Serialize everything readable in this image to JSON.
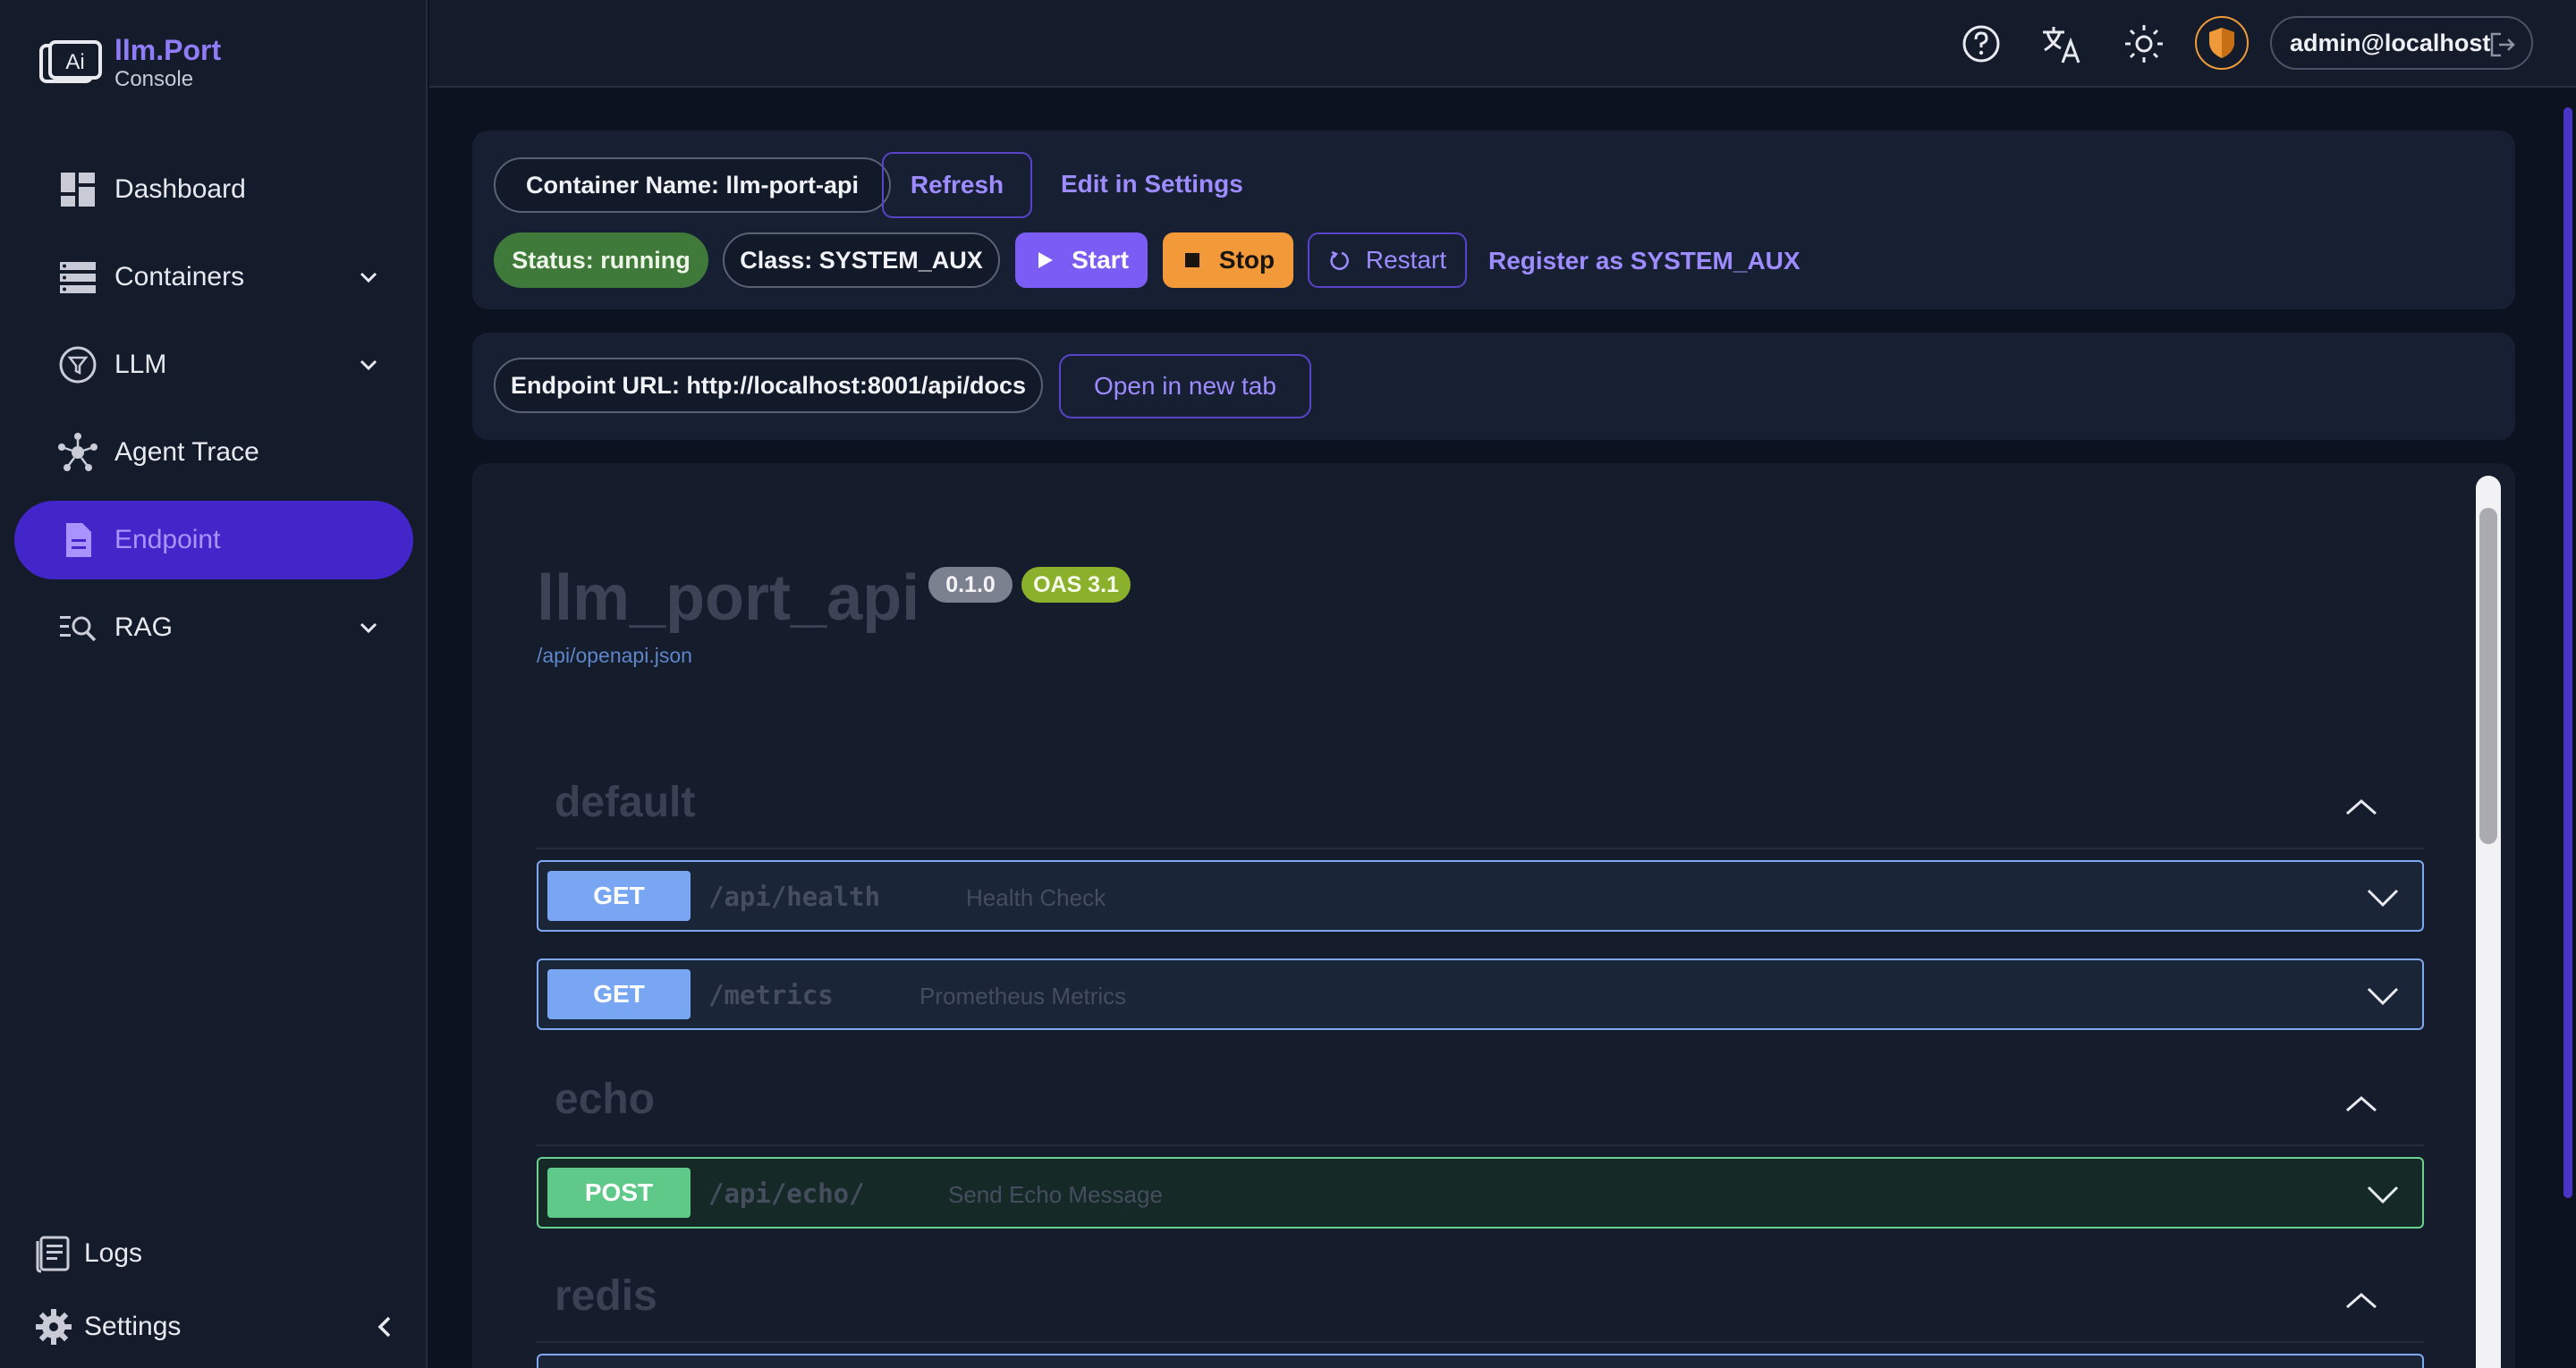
{
  "brand": {
    "name": "llm.Port",
    "subtitle": "Console"
  },
  "sidebar": {
    "items": [
      {
        "label": "Dashboard",
        "icon": "dashboard-icon"
      },
      {
        "label": "Containers",
        "icon": "server-stack-icon"
      },
      {
        "label": "LLM",
        "icon": "filter-funnel-icon"
      },
      {
        "label": "Agent Trace",
        "icon": "network-nodes-icon"
      },
      {
        "label": "Endpoint",
        "icon": "document-icon",
        "active": true
      },
      {
        "label": "RAG",
        "icon": "search-list-icon"
      }
    ],
    "footer": [
      {
        "label": "Logs",
        "icon": "logs-icon"
      },
      {
        "label": "Settings",
        "icon": "gear-icon"
      }
    ]
  },
  "topbar": {
    "user": "admin@localhost"
  },
  "container": {
    "name_chip": "Container Name: llm-port-api",
    "refresh_label": "Refresh",
    "edit_label": "Edit in Settings",
    "status_chip": "Status: running",
    "class_chip": "Class: SYSTEM_AUX",
    "start_label": "Start",
    "stop_label": "Stop",
    "restart_label": "Restart",
    "register_label": "Register as SYSTEM_AUX"
  },
  "endpoint": {
    "url_chip": "Endpoint URL: http://localhost:8001/api/docs",
    "open_label": "Open in new tab"
  },
  "swagger": {
    "title": "llm_port_api",
    "version": "0.1.0",
    "oas": "OAS 3.1",
    "spec_link": "/api/openapi.json",
    "tags": [
      {
        "name": "default",
        "ops": [
          {
            "method": "GET",
            "path": "/api/health",
            "summary": "Health Check"
          },
          {
            "method": "GET",
            "path": "/metrics",
            "summary": "Prometheus Metrics"
          }
        ]
      },
      {
        "name": "echo",
        "ops": [
          {
            "method": "POST",
            "path": "/api/echo/",
            "summary": "Send Echo Message"
          }
        ]
      },
      {
        "name": "redis",
        "ops": []
      }
    ]
  },
  "colors": {
    "accent": "#4326c9",
    "accent_text": "#9d8bff",
    "status_green": "#3f7a3a",
    "stop_orange": "#f29a3a"
  }
}
